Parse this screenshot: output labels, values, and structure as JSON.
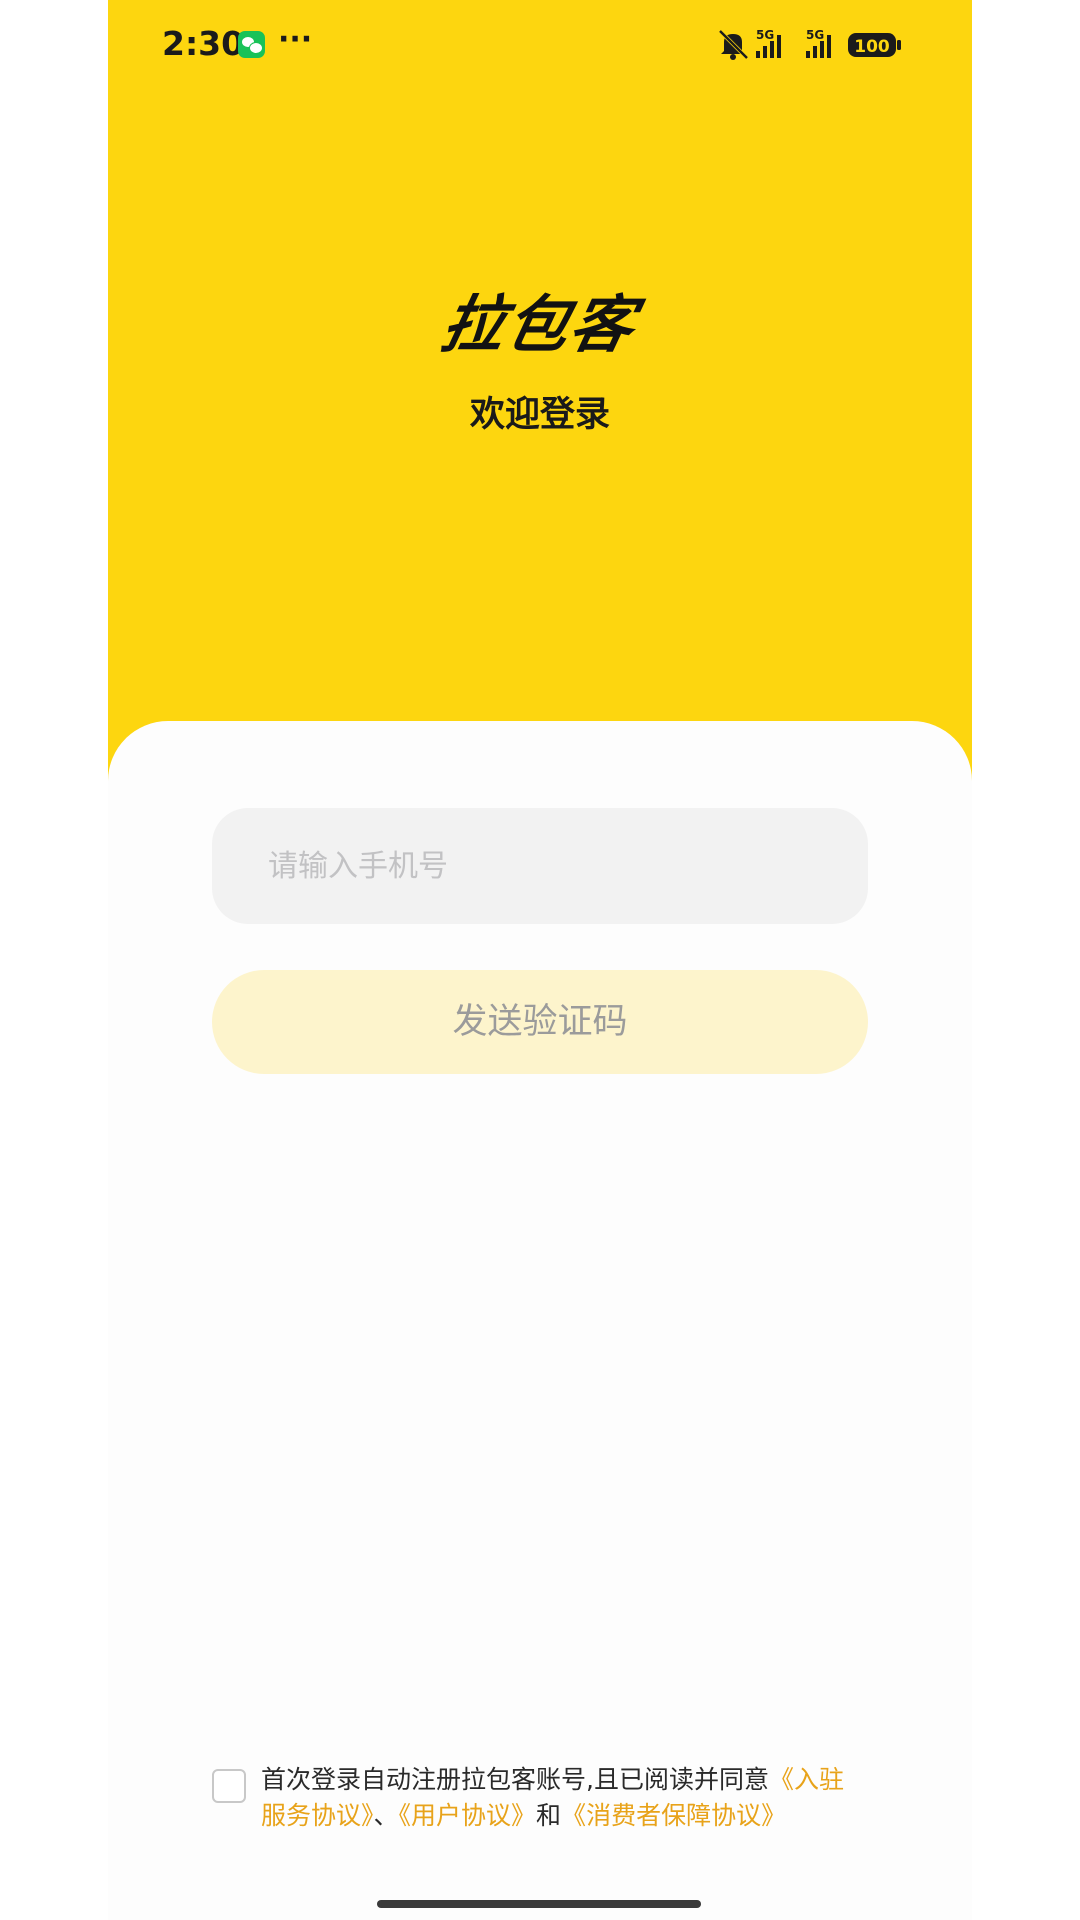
{
  "status_bar": {
    "time": "2:30",
    "more": "···",
    "network_1": "5G",
    "network_2": "5G",
    "battery": "100",
    "icons": [
      "wechat-icon",
      "mute-icon",
      "signal-icon",
      "battery-icon"
    ]
  },
  "header": {
    "logo_text": "拉包客",
    "welcome": "欢迎登录",
    "bg_color": "#fdd60f"
  },
  "form": {
    "phone_placeholder": "请输入手机号",
    "phone_value": "",
    "send_code_label": "发送验证码"
  },
  "agreement": {
    "checked": false,
    "prefix": "首次登录自动注册拉包客账号,且已阅读并同意",
    "link_service": "《入驻服务协议》",
    "sep1": "、",
    "link_user": "《用户协议》",
    "sep2": "和",
    "link_consumer": "《消费者保障协议》",
    "link_color": "#e8a31a"
  }
}
